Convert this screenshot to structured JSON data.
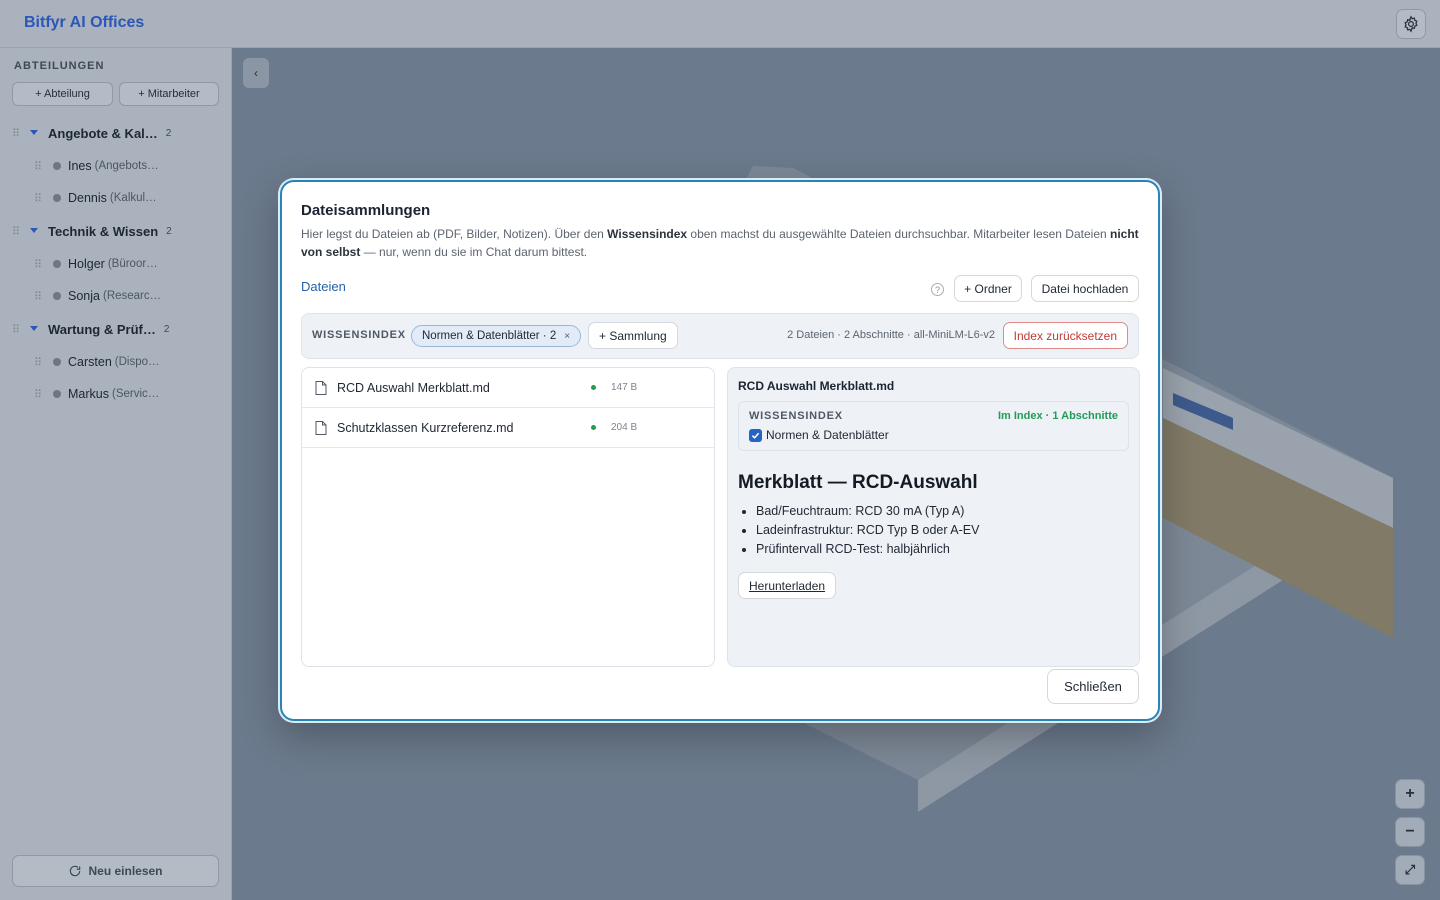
{
  "app": {
    "title": "Bitfyr AI Offices"
  },
  "sidebar": {
    "heading": "ABTEILUNGEN",
    "add_department": "+ Abteilung",
    "add_employee": "+ Mitarbeiter",
    "departments": [
      {
        "name": "Angebote & Kal…",
        "count": "2",
        "employees": [
          {
            "name": "Ines",
            "role": "(Angebots…"
          },
          {
            "name": "Dennis",
            "role": "(Kalkul…"
          }
        ]
      },
      {
        "name": "Technik & Wissen",
        "count": "2",
        "employees": [
          {
            "name": "Holger",
            "role": "(Büroor…"
          },
          {
            "name": "Sonja",
            "role": "(Researc…"
          }
        ]
      },
      {
        "name": "Wartung & Prüf…",
        "count": "2",
        "employees": [
          {
            "name": "Carsten",
            "role": "(Dispo…"
          },
          {
            "name": "Markus",
            "role": "(Servic…"
          }
        ]
      }
    ],
    "refresh_label": "Neu einlesen"
  },
  "canvas": {
    "zoom_in": "+",
    "zoom_out": "−",
    "fit": "⤢"
  },
  "modal": {
    "title": "Dateisammlungen",
    "desc_1": "Hier legst du Dateien ab (PDF, Bilder, Notizen). Über den ",
    "desc_bold_1": "Wissensindex",
    "desc_2": " oben machst du ausgewählte Dateien durchsuchbar. Mitarbeiter lesen Dateien ",
    "desc_bold_2": "nicht von selbst",
    "desc_3": " — nur, wenn du sie im Chat darum bittest.",
    "tab_files": "Dateien",
    "help": "?",
    "new_folder": "+ Ordner",
    "upload": "Datei hochladen",
    "index": {
      "label": "WISSENSINDEX",
      "chip": "Normen & Datenblätter · 2",
      "chip_remove": "×",
      "add_collection": "+ Sammlung",
      "stats": "2 Dateien · 2 Abschnitte · all-MiniLM-L6-v2",
      "reset": "Index zurücksetzen"
    },
    "files": [
      {
        "name": "RCD Auswahl Merkblatt.md",
        "size": "147 B",
        "status_color": "#1f9d55"
      },
      {
        "name": "Schutzklassen Kurzreferenz.md",
        "size": "204 B",
        "status_color": "#1f9d55"
      }
    ],
    "preview": {
      "file_title": "RCD Auswahl Merkblatt.md",
      "index_label": "WISSENSINDEX",
      "index_status": "Im Index · 1 Abschnitte",
      "collection_checked": true,
      "collection_name": "Normen & Datenblätter",
      "heading": "Merkblatt — RCD-Auswahl",
      "bullets": [
        "Bad/Feuchtraum: RCD 30 mA (Typ A)",
        "Ladeinfrastruktur: RCD Typ B oder A-EV",
        "Prüfintervall RCD-Test: halbjährlich"
      ],
      "download": "Herunterladen"
    },
    "close": "Schließen"
  },
  "colors": {
    "accent": "#2563c4",
    "link": "#2563a8",
    "modal_border": "#2a83b6",
    "success": "#1f9d55",
    "danger": "#c13b3b"
  }
}
